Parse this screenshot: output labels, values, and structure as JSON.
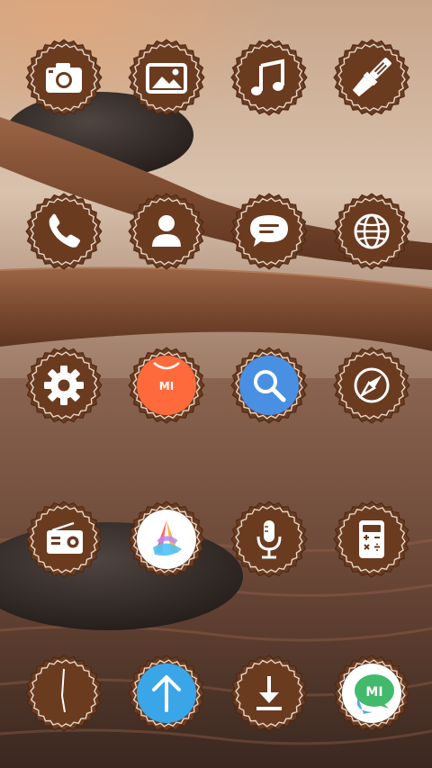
{
  "screen": {
    "type": "home-screen",
    "theme": "wooden-bottlecap-icons"
  },
  "colors": {
    "badge": "#6b3b20",
    "badge_dark": "#4a2612",
    "badge_ring": "#f3e9dc",
    "glyph": "#ffffff",
    "mi_orange": "#ff6a3d",
    "search_blue": "#4a90e2",
    "upload_blue": "#3aa6e8",
    "chat_green": "#43b96b"
  },
  "apps": [
    {
      "id": "camera",
      "icon": "camera-icon"
    },
    {
      "id": "gallery",
      "icon": "image-icon"
    },
    {
      "id": "music",
      "icon": "music-note-icon"
    },
    {
      "id": "themes",
      "icon": "paintbrush-icon"
    },
    {
      "id": "phone",
      "icon": "phone-icon"
    },
    {
      "id": "contacts",
      "icon": "person-icon"
    },
    {
      "id": "messages",
      "icon": "chat-bubble-icon"
    },
    {
      "id": "browser",
      "icon": "globe-icon"
    },
    {
      "id": "settings",
      "icon": "gear-icon"
    },
    {
      "id": "mi-store",
      "icon": "mi-bag-icon",
      "label": "MI"
    },
    {
      "id": "search",
      "icon": "magnifier-icon"
    },
    {
      "id": "compass",
      "icon": "compass-icon"
    },
    {
      "id": "fm-radio",
      "icon": "radio-icon"
    },
    {
      "id": "mi-launcher",
      "icon": "colorful-a-icon"
    },
    {
      "id": "recorder",
      "icon": "microphone-icon"
    },
    {
      "id": "calculator",
      "icon": "calculator-icon"
    },
    {
      "id": "clock",
      "icon": "clock-icon"
    },
    {
      "id": "updater",
      "icon": "up-arrow-icon"
    },
    {
      "id": "downloads",
      "icon": "download-icon"
    },
    {
      "id": "mi-talk",
      "icon": "mi-chat-icon",
      "label": "MI"
    }
  ]
}
